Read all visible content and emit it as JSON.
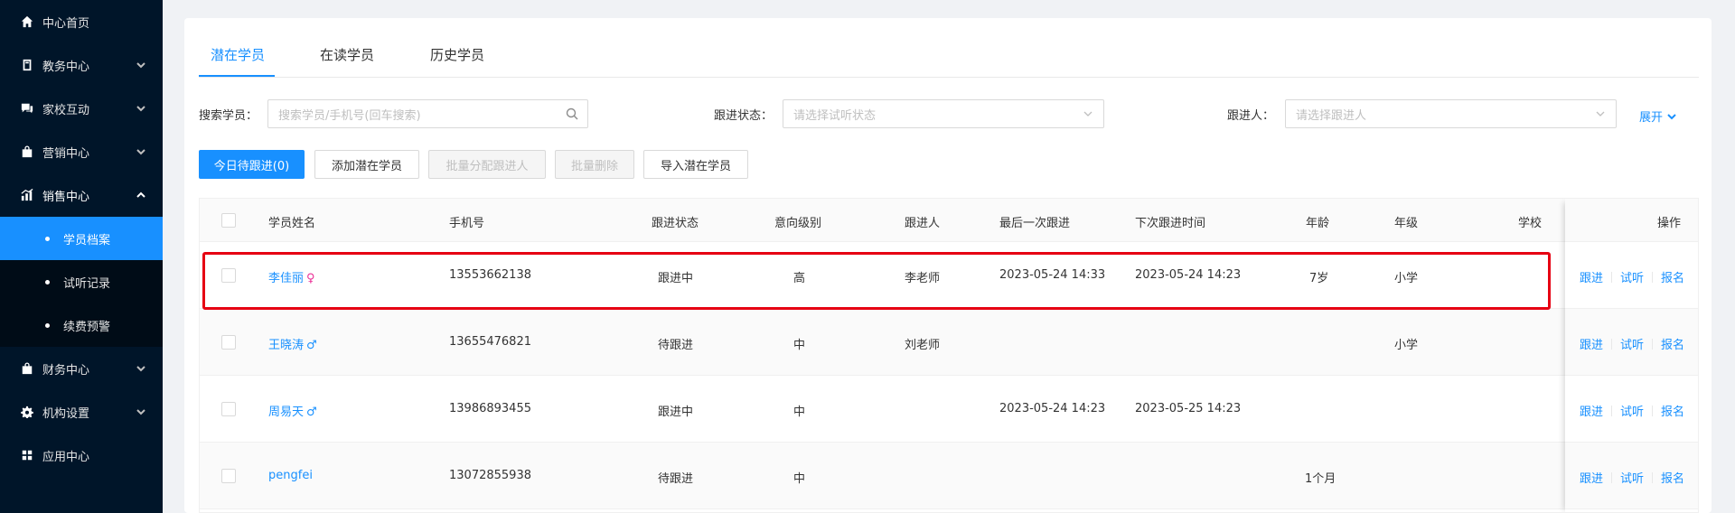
{
  "sidebar": {
    "items": [
      {
        "label": "中心首页",
        "icon": "home-icon"
      },
      {
        "label": "教务中心",
        "icon": "book-icon"
      },
      {
        "label": "家校互动",
        "icon": "chat-icon"
      },
      {
        "label": "营销中心",
        "icon": "bag-icon"
      },
      {
        "label": "销售中心",
        "icon": "chart-icon"
      }
    ],
    "sub_items": [
      {
        "label": "学员档案"
      },
      {
        "label": "试听记录"
      },
      {
        "label": "续费预警"
      }
    ],
    "bottom_items": [
      {
        "label": "财务中心",
        "icon": "wallet-icon"
      },
      {
        "label": "机构设置",
        "icon": "gear-icon"
      },
      {
        "label": "应用中心",
        "icon": "grid-icon"
      }
    ]
  },
  "tabs": [
    {
      "label": "潜在学员"
    },
    {
      "label": "在读学员"
    },
    {
      "label": "历史学员"
    }
  ],
  "filters": {
    "search_label": "搜索学员：",
    "search_placeholder": "搜索学员/手机号(回车搜索)",
    "status_label": "跟进状态：",
    "status_placeholder": "请选择试听状态",
    "follower_label": "跟进人：",
    "follower_placeholder": "请选择跟进人",
    "expand_label": "展开"
  },
  "buttons": {
    "today": "今日待跟进(0)",
    "add": "添加潜在学员",
    "batch_assign": "批量分配跟进人",
    "batch_delete": "批量删除",
    "import": "导入潜在学员"
  },
  "table": {
    "headers": {
      "name": "学员姓名",
      "phone": "手机号",
      "status": "跟进状态",
      "intent": "意向级别",
      "follower": "跟进人",
      "last_follow": "最后一次跟进",
      "next_follow": "下次跟进时间",
      "age": "年龄",
      "grade": "年级",
      "school": "学校",
      "ops": "操作"
    },
    "rows": [
      {
        "name": "李佳丽",
        "gender": "♀",
        "phone": "13553662138",
        "status": "跟进中",
        "intent": "高",
        "follower": "李老师",
        "last_follow": "2023-05-24 14:33",
        "next_follow": "2023-05-24 14:23",
        "age": "7岁",
        "grade": "小学",
        "school": ""
      },
      {
        "name": "王晓涛",
        "gender": "♂",
        "phone": "13655476821",
        "status": "待跟进",
        "intent": "中",
        "follower": "刘老师",
        "last_follow": "",
        "next_follow": "",
        "age": "",
        "grade": "小学",
        "school": ""
      },
      {
        "name": "周易天",
        "gender": "♂",
        "phone": "13986893455",
        "status": "跟进中",
        "intent": "中",
        "follower": "",
        "last_follow": "2023-05-24 14:23",
        "next_follow": "2023-05-25 14:23",
        "age": "",
        "grade": "",
        "school": ""
      },
      {
        "name": "pengfei",
        "gender": "",
        "phone": "13072855938",
        "status": "待跟进",
        "intent": "中",
        "follower": "",
        "last_follow": "",
        "next_follow": "",
        "age": "1个月",
        "grade": "",
        "school": ""
      }
    ],
    "ops": {
      "follow": "跟进",
      "trial": "试听",
      "enroll": "报名"
    }
  },
  "colors": {
    "sidebar_bg": "#001529",
    "accent": "#1890ff",
    "highlight": "#e60012",
    "female": "#eb2f96"
  }
}
